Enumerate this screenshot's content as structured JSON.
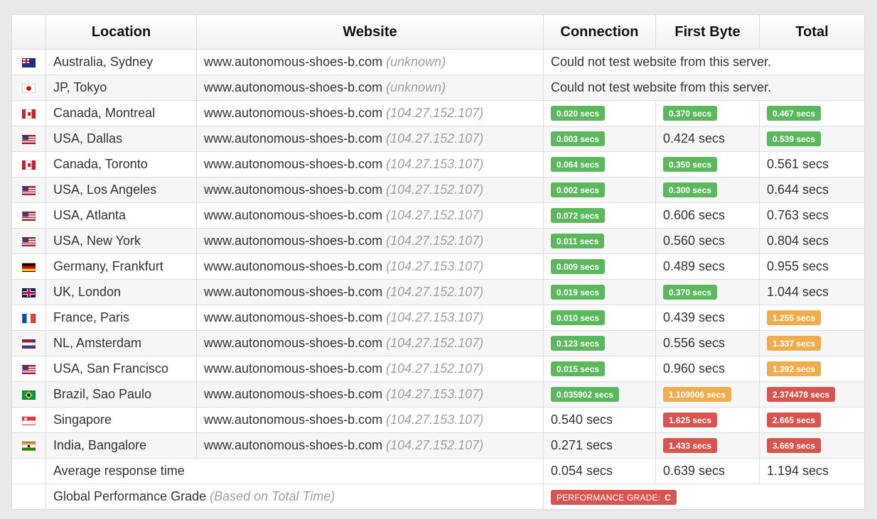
{
  "headers": {
    "location": "Location",
    "website": "Website",
    "connection": "Connection",
    "first_byte": "First Byte",
    "total": "Total"
  },
  "status_colors": {
    "green": "#5cb85c",
    "orange": "#f0ad4e",
    "red": "#d9534f"
  },
  "rows": [
    {
      "flag": "au-flag-icon",
      "location": "Australia, Sydney",
      "website": "www.autonomous-shoes-b.com",
      "ip": "(unknown)",
      "message": "Could not test website from this server."
    },
    {
      "flag": "jp-flag-icon",
      "location": "JP, Tokyo",
      "website": "www.autonomous-shoes-b.com",
      "ip": "(unknown)",
      "message": "Could not test website from this server."
    },
    {
      "flag": "ca-flag-icon",
      "location": "Canada, Montreal",
      "website": "www.autonomous-shoes-b.com",
      "ip": "(104.27.152.107)",
      "connection": {
        "text": "0.020 secs",
        "status": "green"
      },
      "first_byte": {
        "text": "0.370 secs",
        "status": "green"
      },
      "total": {
        "text": "0.467 secs",
        "status": "green"
      }
    },
    {
      "flag": "us-flag-icon",
      "location": "USA, Dallas",
      "website": "www.autonomous-shoes-b.com",
      "ip": "(104.27.152.107)",
      "connection": {
        "text": "0.003 secs",
        "status": "green"
      },
      "first_byte": {
        "text": "0.424 secs",
        "status": ""
      },
      "total": {
        "text": "0.539 secs",
        "status": "green"
      }
    },
    {
      "flag": "ca-flag-icon",
      "location": "Canada, Toronto",
      "website": "www.autonomous-shoes-b.com",
      "ip": "(104.27.153.107)",
      "connection": {
        "text": "0.064 secs",
        "status": "green"
      },
      "first_byte": {
        "text": "0.350 secs",
        "status": "green"
      },
      "total": {
        "text": "0.561 secs",
        "status": ""
      }
    },
    {
      "flag": "us-flag-icon",
      "location": "USA, Los Angeles",
      "website": "www.autonomous-shoes-b.com",
      "ip": "(104.27.152.107)",
      "connection": {
        "text": "0.002 secs",
        "status": "green"
      },
      "first_byte": {
        "text": "0.300 secs",
        "status": "green"
      },
      "total": {
        "text": "0.644 secs",
        "status": ""
      }
    },
    {
      "flag": "us-flag-icon",
      "location": "USA, Atlanta",
      "website": "www.autonomous-shoes-b.com",
      "ip": "(104.27.152.107)",
      "connection": {
        "text": "0.072 secs",
        "status": "green"
      },
      "first_byte": {
        "text": "0.606 secs",
        "status": ""
      },
      "total": {
        "text": "0.763 secs",
        "status": ""
      }
    },
    {
      "flag": "us-flag-icon",
      "location": "USA, New York",
      "website": "www.autonomous-shoes-b.com",
      "ip": "(104.27.152.107)",
      "connection": {
        "text": "0.011 secs",
        "status": "green"
      },
      "first_byte": {
        "text": "0.560 secs",
        "status": ""
      },
      "total": {
        "text": "0.804 secs",
        "status": ""
      }
    },
    {
      "flag": "de-flag-icon",
      "location": "Germany, Frankfurt",
      "website": "www.autonomous-shoes-b.com",
      "ip": "(104.27.153.107)",
      "connection": {
        "text": "0.009 secs",
        "status": "green"
      },
      "first_byte": {
        "text": "0.489 secs",
        "status": ""
      },
      "total": {
        "text": "0.955 secs",
        "status": ""
      }
    },
    {
      "flag": "gb-flag-icon",
      "location": "UK, London",
      "website": "www.autonomous-shoes-b.com",
      "ip": "(104.27.152.107)",
      "connection": {
        "text": "0.019 secs",
        "status": "green"
      },
      "first_byte": {
        "text": "0.370 secs",
        "status": "green"
      },
      "total": {
        "text": "1.044 secs",
        "status": ""
      }
    },
    {
      "flag": "fr-flag-icon",
      "location": "France, Paris",
      "website": "www.autonomous-shoes-b.com",
      "ip": "(104.27.153.107)",
      "connection": {
        "text": "0.010 secs",
        "status": "green"
      },
      "first_byte": {
        "text": "0.439 secs",
        "status": ""
      },
      "total": {
        "text": "1.255 secs",
        "status": "orange"
      }
    },
    {
      "flag": "nl-flag-icon",
      "location": "NL, Amsterdam",
      "website": "www.autonomous-shoes-b.com",
      "ip": "(104.27.152.107)",
      "connection": {
        "text": "0.123 secs",
        "status": "green"
      },
      "first_byte": {
        "text": "0.556 secs",
        "status": ""
      },
      "total": {
        "text": "1.337 secs",
        "status": "orange"
      }
    },
    {
      "flag": "us-flag-icon",
      "location": "USA, San Francisco",
      "website": "www.autonomous-shoes-b.com",
      "ip": "(104.27.152.107)",
      "connection": {
        "text": "0.015 secs",
        "status": "green"
      },
      "first_byte": {
        "text": "0.960 secs",
        "status": ""
      },
      "total": {
        "text": "1.392 secs",
        "status": "orange"
      }
    },
    {
      "flag": "br-flag-icon",
      "location": "Brazil, Sao Paulo",
      "website": "www.autonomous-shoes-b.com",
      "ip": "(104.27.153.107)",
      "connection": {
        "text": "0.035902 secs",
        "status": "green"
      },
      "first_byte": {
        "text": "1.109006 secs",
        "status": "orange"
      },
      "total": {
        "text": "2.374478 secs",
        "status": "red"
      }
    },
    {
      "flag": "sg-flag-icon",
      "location": "Singapore",
      "website": "www.autonomous-shoes-b.com",
      "ip": "(104.27.153.107)",
      "connection": {
        "text": "0.540 secs",
        "status": ""
      },
      "first_byte": {
        "text": "1.625 secs",
        "status": "red"
      },
      "total": {
        "text": "2.665 secs",
        "status": "red"
      }
    },
    {
      "flag": "in-flag-icon",
      "location": "India, Bangalore",
      "website": "www.autonomous-shoes-b.com",
      "ip": "(104.27.152.107)",
      "connection": {
        "text": "0.271 secs",
        "status": ""
      },
      "first_byte": {
        "text": "1.433 secs",
        "status": "red"
      },
      "total": {
        "text": "3.669 secs",
        "status": "red"
      }
    }
  ],
  "average": {
    "label": "Average response time",
    "connection": "0.054 secs",
    "first_byte": "0.639 secs",
    "total": "1.194 secs"
  },
  "grade": {
    "label": "Global Performance Grade",
    "note": "(Based on Total Time)",
    "badge_label": "PERFORMANCE GRADE:",
    "badge_value": "C"
  }
}
